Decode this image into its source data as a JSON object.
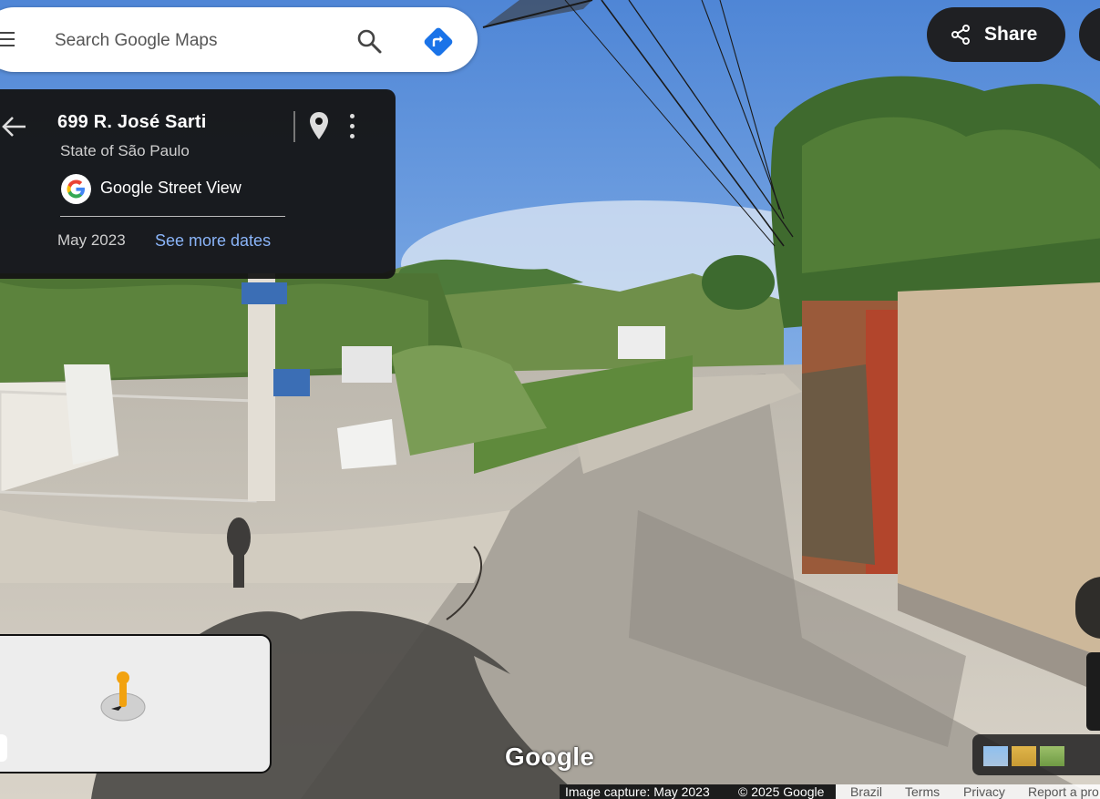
{
  "search": {
    "placeholder": "Search Google Maps"
  },
  "header": {
    "share_label": "Share"
  },
  "location": {
    "address": "699 R. José Sarti",
    "region": "State of São Paulo",
    "source": "Google Street View",
    "capture_month": "May 2023",
    "see_more_dates": "See more dates"
  },
  "watermark": "Google",
  "footer": {
    "image_capture": "Image capture: May 2023",
    "copyright": "© 2025 Google",
    "country": "Brazil",
    "terms": "Terms",
    "privacy": "Privacy",
    "report": "Report a pro"
  },
  "colors": {
    "accent_blue": "#1a73e8",
    "link_blue": "#8ab4f8",
    "panel_dark": "#141414"
  },
  "icons": [
    "menu-icon",
    "search-icon",
    "directions-icon",
    "share-icon",
    "back-arrow-icon",
    "map-pin-icon",
    "more-vert-icon",
    "google-g-icon",
    "pegman-icon",
    "expand-icon"
  ]
}
